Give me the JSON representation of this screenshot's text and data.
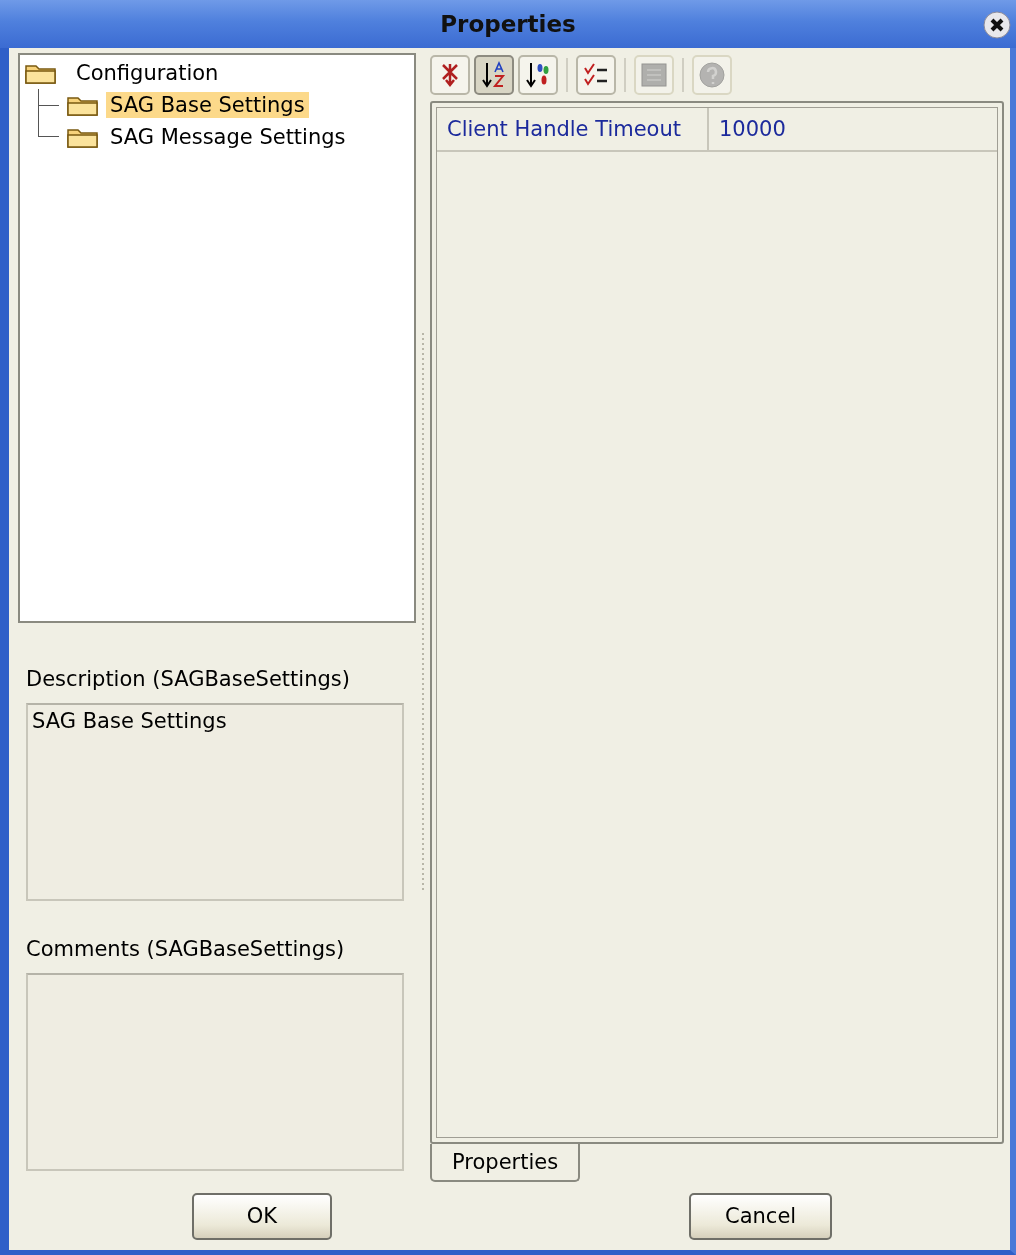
{
  "window": {
    "title": "Properties"
  },
  "tree": [
    {
      "label": "Configuration",
      "selected": false,
      "children": [
        {
          "label": "SAG Base Settings",
          "selected": true
        },
        {
          "label": "SAG Message Settings",
          "selected": false
        }
      ]
    }
  ],
  "toolbar": [
    {
      "selected": false,
      "disabled": false
    },
    {
      "selected": true,
      "disabled": false
    },
    {
      "selected": false,
      "disabled": false
    },
    {
      "selected": false,
      "disabled": false
    },
    {
      "selected": false,
      "disabled": true
    },
    {
      "selected": false,
      "disabled": true
    }
  ],
  "description": {
    "label": "Description (SAGBaseSettings)",
    "value": "SAG Base Settings"
  },
  "comments": {
    "label": "Comments (SAGBaseSettings)"
  },
  "properties": [
    {
      "name": "Client Handle Timeout",
      "value": "10000"
    }
  ],
  "tabs": [
    {
      "label": "Properties",
      "selected": true
    }
  ],
  "buttons": [
    "OK",
    "Cancel"
  ]
}
